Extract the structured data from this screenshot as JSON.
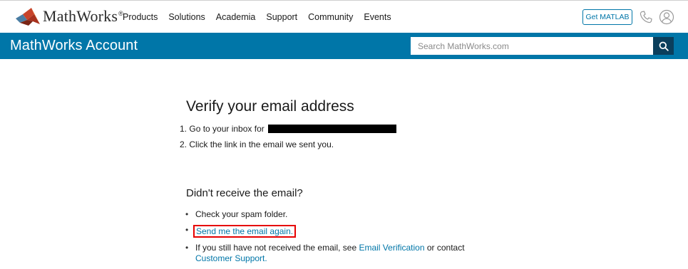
{
  "header": {
    "brand": "MathWorks",
    "brand_reg": "®",
    "nav": [
      "Products",
      "Solutions",
      "Academia",
      "Support",
      "Community",
      "Events"
    ],
    "get_matlab": "Get MATLAB",
    "icons": {
      "phone": "phone-icon",
      "account": "user-icon",
      "logo": "membrane-logo-icon"
    },
    "colors": {
      "accent": "#0076a8",
      "logo_red": "#c8442b",
      "logo_orange": "#e87d2a"
    }
  },
  "accountbar": {
    "title": "MathWorks Account",
    "search_placeholder": "Search MathWorks.com",
    "search_icon": "search-icon",
    "color": "#0076a8"
  },
  "main": {
    "title": "Verify your email address",
    "steps": [
      {
        "num": "1.",
        "text": "Go to your inbox for"
      },
      {
        "num": "2.",
        "text": "Click the link in the email we sent you."
      }
    ],
    "subtitle": "Didn't receive the email?",
    "tips": {
      "spam": "Check your spam folder.",
      "resend": "Send me the email again.",
      "still_pre": "If you still have not received the email, see",
      "email_verification": "Email Verification",
      "still_mid": "or contact",
      "customer_support": "Customer Support",
      "still_end": "."
    }
  }
}
